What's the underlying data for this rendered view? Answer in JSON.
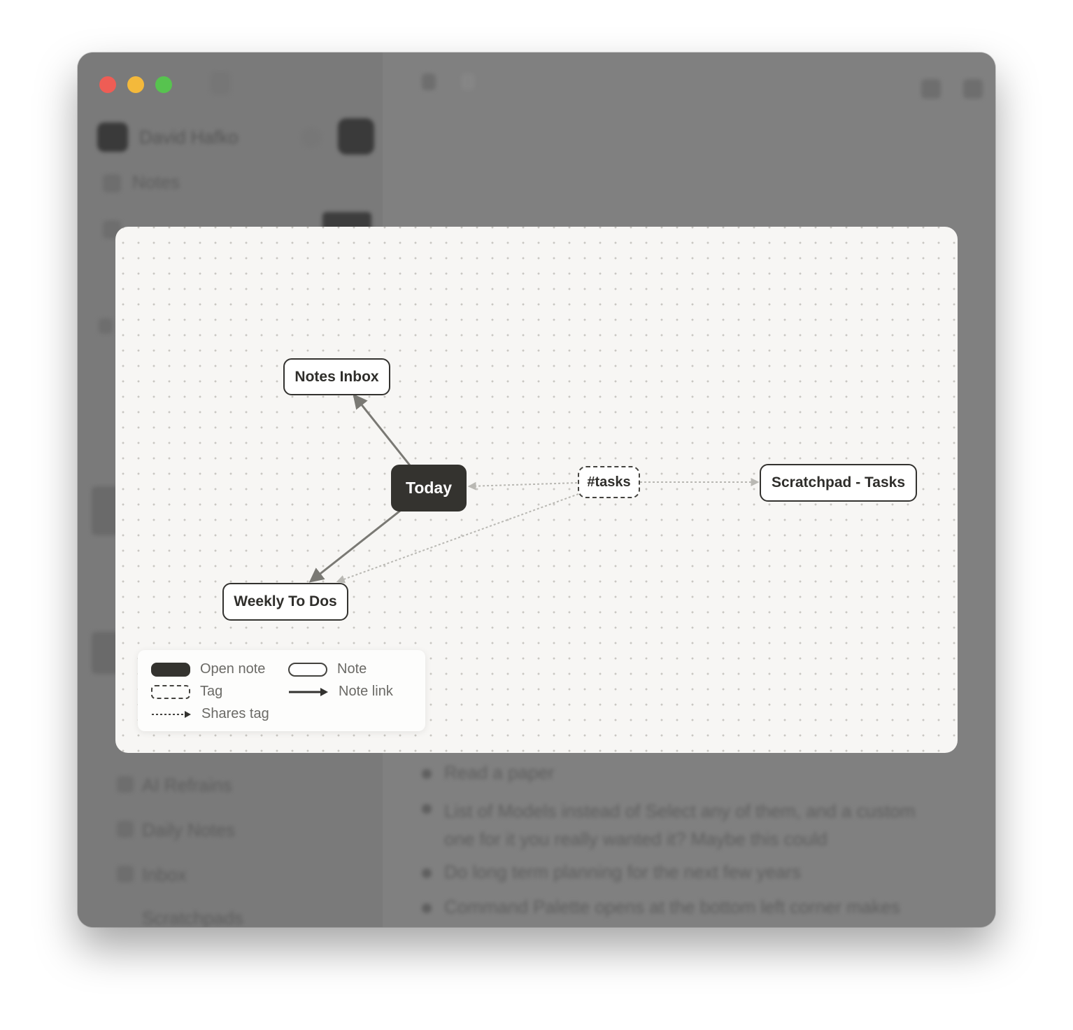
{
  "sidebar": {
    "workspace_name": "David Hafko",
    "items": [
      "Notes",
      "AI Refrains",
      "Daily Notes",
      "Inbox",
      "Scratchpads"
    ]
  },
  "document": {
    "bullets": [
      "Read a paper",
      "List of Models instead of Select any of them, and a custom one for it you really wanted it? Maybe this could",
      "Do long term planning for the next few years",
      "Command Palette opens at the bottom left corner makes"
    ]
  },
  "graph": {
    "nodes": {
      "notes_inbox": "Notes Inbox",
      "today": "Today",
      "weekly_todos": "Weekly To Dos",
      "tasks_tag": "#tasks",
      "scratchpad": "Scratchpad - Tasks"
    },
    "edges": [
      {
        "from": "today",
        "to": "notes_inbox",
        "kind": "note-link"
      },
      {
        "from": "today",
        "to": "weekly_todos",
        "kind": "note-link"
      },
      {
        "from": "tasks_tag",
        "to": "today",
        "kind": "shares-tag"
      },
      {
        "from": "tasks_tag",
        "to": "weekly_todos",
        "kind": "shares-tag"
      },
      {
        "from": "tasks_tag",
        "to": "scratchpad",
        "kind": "shares-tag"
      }
    ]
  },
  "legend": {
    "open_note": "Open note",
    "note": "Note",
    "tag": "Tag",
    "note_link": "Note link",
    "shares_tag": "Shares tag"
  },
  "colors": {
    "open_node": "#34332f",
    "canvas": "#f7f6f4",
    "note_link_edge": "#7a7974",
    "shares_tag_edge": "#b9b8b3"
  }
}
